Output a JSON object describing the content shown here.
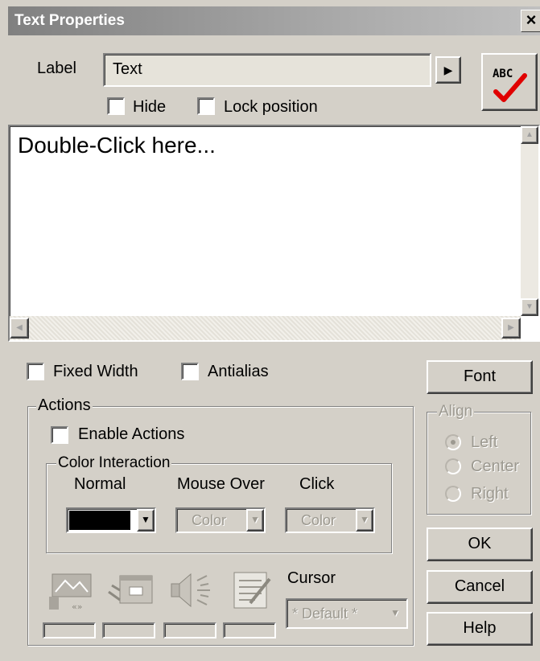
{
  "window": {
    "title": "Text Properties",
    "close_glyph": "×"
  },
  "label_row": {
    "label": "Label",
    "value": "Text",
    "arrow_glyph": "▶",
    "spellcheck_text": "ABC"
  },
  "checks_top": {
    "hide": "Hide",
    "lock_position": "Lock position"
  },
  "editor": {
    "content": "Double-Click here..."
  },
  "checks_mid": {
    "fixed_width": "Fixed Width",
    "antialias": "Antialias"
  },
  "buttons": {
    "font": "Font",
    "ok": "OK",
    "cancel": "Cancel",
    "help": "Help"
  },
  "align": {
    "legend": "Align",
    "left": "Left",
    "center": "Center",
    "right": "Right",
    "selected": "Left"
  },
  "actions": {
    "legend": "Actions",
    "enable_actions": "Enable Actions",
    "color_interaction": {
      "legend": "Color Interaction",
      "normal": "Normal",
      "mouse_over": "Mouse Over",
      "click": "Click",
      "mouse_over_value": "Color",
      "click_value": "Color",
      "normal_color": "#000000"
    },
    "cursor_label": "Cursor",
    "cursor_value": "* Default *",
    "icons": [
      "image-action-icon",
      "window-action-icon",
      "sound-action-icon",
      "notes-action-icon"
    ]
  }
}
